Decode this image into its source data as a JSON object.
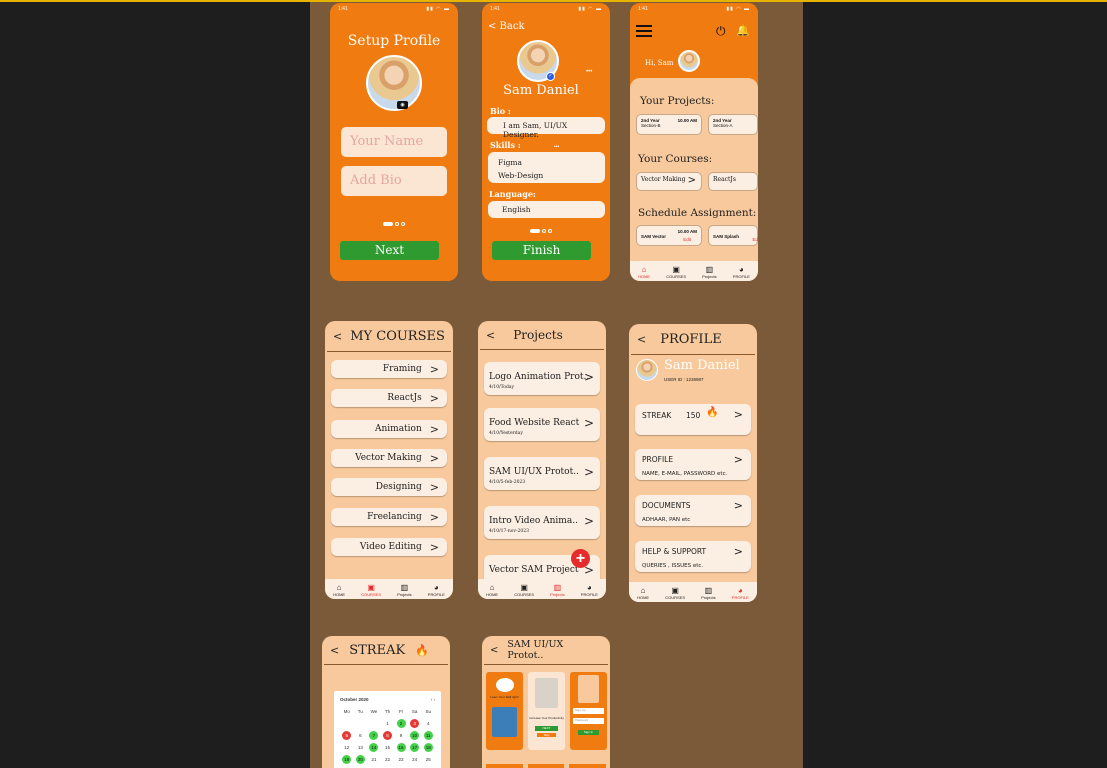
{
  "status_time": "1:41",
  "colors": {
    "orange": "#f07b10",
    "peach": "#f7c99c",
    "green": "#2f9a2f",
    "red": "#e52b2b",
    "canvas": "#7a5a38"
  },
  "setup_profile": {
    "title": "Setup Profile",
    "name_placeholder": "Your Name",
    "bio_placeholder": "Add Bio",
    "next_label": "Next"
  },
  "setup_bio": {
    "back_label": "< Back",
    "name": "Sam Daniel",
    "bio_label": "Bio :",
    "bio_value": "I am Sam,  UI/UX Designer.",
    "skills_label": "Skills :",
    "skills": [
      "Figma",
      "Web-Design"
    ],
    "language_label": "Language:",
    "language_value": "English",
    "finish_label": "Finish"
  },
  "home": {
    "greeting": "Hi, Sam",
    "projects_title": "Your Projects:",
    "project_cards": [
      {
        "year": "2nd Year",
        "time": "10.00 AM",
        "section": "Section-B"
      },
      {
        "year": "2nd Year",
        "time": "",
        "section": "Section-A"
      }
    ],
    "courses_title": "Your Courses:",
    "course_cards": [
      "Vector Making",
      "ReactJs"
    ],
    "assign_title": "Schedule Assignment:",
    "assign_cards": [
      {
        "name": "SAM Vector",
        "time": "10.00 AM",
        "tag": "Edit"
      },
      {
        "name": "SAM Splash",
        "time": "",
        "tag": "Ed"
      }
    ]
  },
  "nav": {
    "home": "HOME",
    "courses": "COURSES",
    "projects": "Projects",
    "profile": "PROFILE"
  },
  "my_courses": {
    "title": "MY COURSES",
    "items": [
      "Framing",
      "ReactJs",
      "Animation",
      "Vector Making",
      "Designing",
      "Freelancing",
      "Video Editing"
    ]
  },
  "projects": {
    "title": "Projects",
    "items": [
      {
        "name": "Logo Animation Prot..",
        "date": "4/10/Today"
      },
      {
        "name": "Food Website React",
        "date": "4/10/Yesterday"
      },
      {
        "name": "SAM UI/UX Protot..",
        "date": "4/10/5-feb-2023"
      },
      {
        "name": "Intro Video Anima..",
        "date": "4/10/17-nov-2023"
      },
      {
        "name": "Vector SAM Project",
        "date": ""
      }
    ]
  },
  "profile": {
    "title": "PROFILE",
    "name": "Sam Daniel",
    "user_id": "USER ID : 1238987",
    "streak_label": "STREAK",
    "streak_count": "150",
    "cards": [
      {
        "title": "PROFILE",
        "sub": "NAME, E-MAIL, PASSWORD etc."
      },
      {
        "title": "DOCUMENTS",
        "sub": "ADHAAR, PAN etc"
      },
      {
        "title": "HELP & SUPPORT",
        "sub": "QUERIES , ISSUES etc."
      }
    ]
  },
  "streak": {
    "title": "STREAK",
    "month": "October 2020",
    "weekdays": [
      "Mo",
      "Tu",
      "We",
      "Th",
      "Fr",
      "Sa",
      "Su"
    ],
    "rows": [
      [
        "",
        "",
        "",
        "1",
        "2",
        "3",
        "4"
      ],
      [
        "5",
        "6",
        "7",
        "8",
        "9",
        "10",
        "11"
      ],
      [
        "12",
        "13",
        "14",
        "15",
        "16",
        "17",
        "18"
      ],
      [
        "19",
        "20",
        "21",
        "22",
        "23",
        "24",
        "25"
      ]
    ]
  },
  "sam_ui": {
    "title": "SAM UI/UX Protot..",
    "screen1_text": "Learn Your Skill right!",
    "screen2_text": "Increase Your Productivity",
    "screen2_btn": "NEXT",
    "screen2_btn2": "Skip",
    "screen3_field1": "Sign Up",
    "screen3_field2": "Password",
    "screen3_btn": "Sign In"
  }
}
